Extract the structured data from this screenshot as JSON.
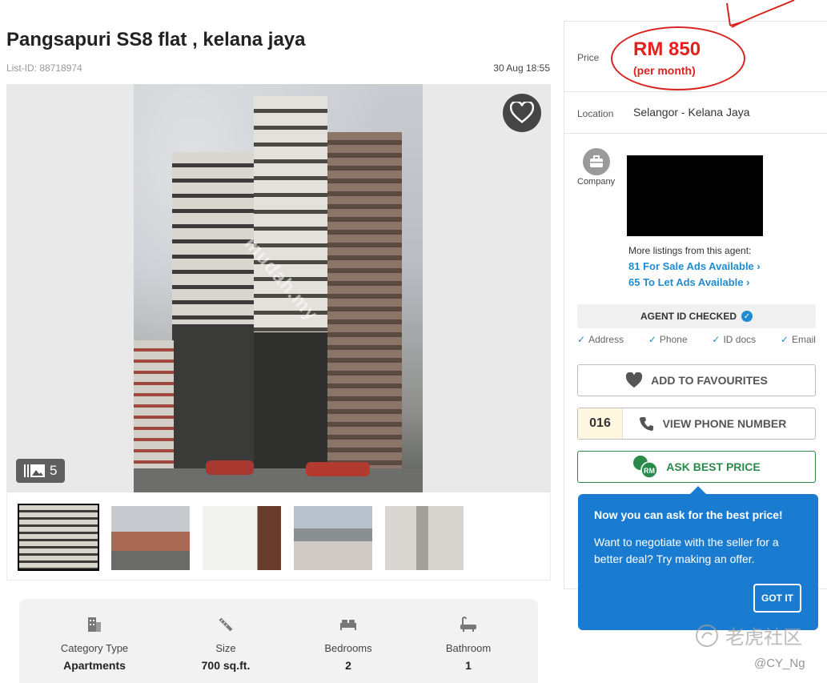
{
  "listing": {
    "title": "Pangsapuri SS8 flat , kelana jaya",
    "list_id": "List-ID: 88718974",
    "date": "30 Aug 18:55",
    "photo_watermark": "mudah.my",
    "photo_count": "5"
  },
  "specs": [
    {
      "label": "Category Type",
      "value": "Apartments",
      "icon": "building-icon"
    },
    {
      "label": "Size",
      "value": "700 sq.ft.",
      "icon": "ruler-icon"
    },
    {
      "label": "Bedrooms",
      "value": "2",
      "icon": "bed-icon"
    },
    {
      "label": "Bathroom",
      "value": "1",
      "icon": "bathtub-icon"
    }
  ],
  "sidebar": {
    "price_label": "Price",
    "price_value": "RM 850",
    "price_period": "(per month)",
    "location_label": "Location",
    "location_value": "Selangor - Kelana Jaya",
    "company_label": "Company",
    "more_listings": "More listings from this agent:",
    "sale_link": "81 For Sale Ads Available  ›",
    "let_link": "65 To Let Ads Available  ›",
    "agent_checked": "AGENT ID CHECKED",
    "checks": [
      "Address",
      "Phone",
      "ID docs",
      "Email"
    ],
    "add_fav": "ADD TO FAVOURITES",
    "phone_prefix": "016",
    "view_phone": "VIEW PHONE NUMBER",
    "ask_price": "ASK BEST PRICE",
    "ask_badge": "RM"
  },
  "tooltip": {
    "title": "Now you can ask for the best price!",
    "body": "Want to negotiate with the seller for a better deal? Try making an offer.",
    "button": "GOT IT"
  },
  "overlay": {
    "forum_watermark": "老虎社区",
    "forum_user": "@CY_Ng"
  },
  "colors": {
    "price_red": "#e0231f",
    "link_blue": "#1e8cd0",
    "tooltip_blue": "#1a7cd0",
    "ask_green": "#2a8a4a"
  }
}
